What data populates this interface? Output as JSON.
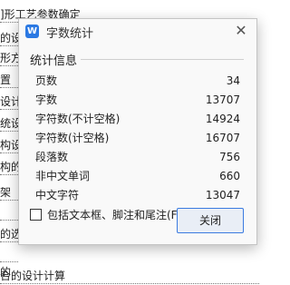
{
  "background_document": {
    "lines": [
      "]形工艺参数确定",
      "的设计",
      "形方",
      "置",
      "设计",
      "统设",
      "构设",
      "构的",
      "架",
      "",
      "的选",
      "",
      "的",
      "合的设计计算"
    ]
  },
  "dialog": {
    "app_icon_glyph": "W",
    "title": "字数统计",
    "close_glyph": "✕",
    "section_title": "统计信息",
    "stats": [
      {
        "label": "页数",
        "value": "34"
      },
      {
        "label": "字数",
        "value": "13707"
      },
      {
        "label": "字符数(不计空格)",
        "value": "14924"
      },
      {
        "label": "字符数(计空格)",
        "value": "16707"
      },
      {
        "label": "段落数",
        "value": "756"
      },
      {
        "label": "非中文单词",
        "value": "660"
      },
      {
        "label": "中文字符",
        "value": "13047"
      }
    ],
    "include_textboxes_label": "包括文本框、脚注和尾注(F)",
    "include_textboxes_checked": false,
    "close_button_label": "关闭"
  },
  "colors": {
    "accent": "#2b79e3",
    "button_border": "#3b7be0"
  }
}
